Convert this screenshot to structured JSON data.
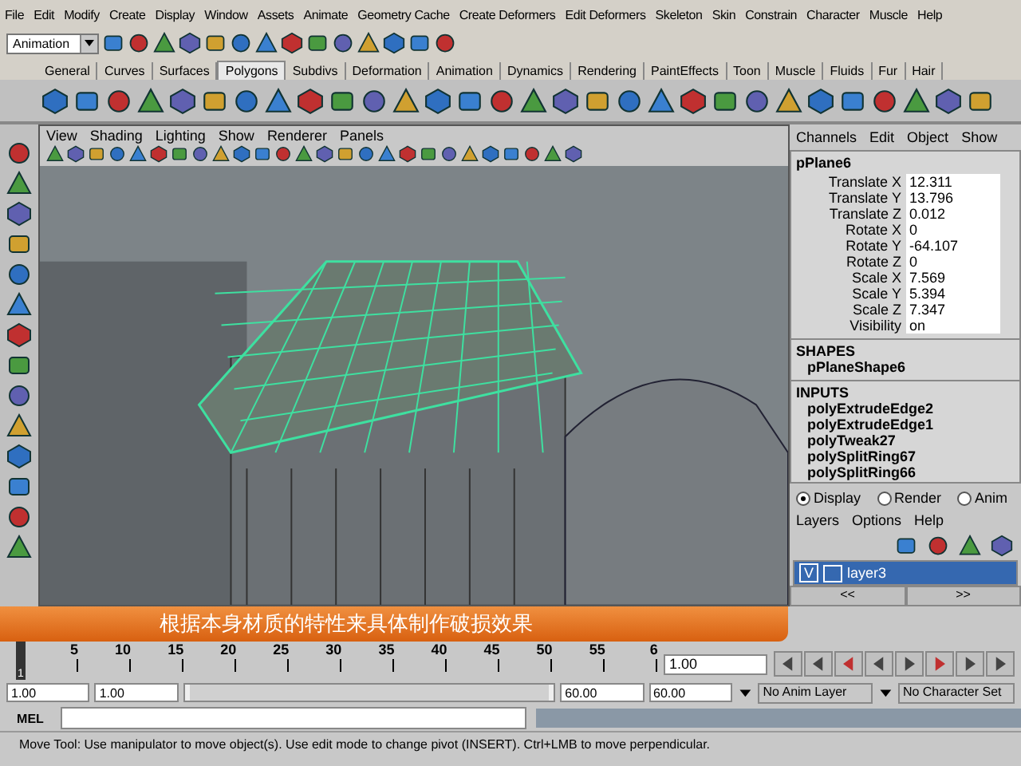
{
  "menu_bar": [
    "File",
    "Edit",
    "Modify",
    "Create",
    "Display",
    "Window",
    "Assets",
    "Animate",
    "Geometry Cache",
    "Create Deformers",
    "Edit Deformers",
    "Skeleton",
    "Skin",
    "Constrain",
    "Character",
    "Muscle",
    "Help"
  ],
  "status_line": {
    "mode": "Animation"
  },
  "shelf_tabs": [
    {
      "label": "General",
      "selected": false
    },
    {
      "label": "Curves",
      "selected": false
    },
    {
      "label": "Surfaces",
      "selected": false
    },
    {
      "label": "Polygons",
      "selected": true
    },
    {
      "label": "Subdivs",
      "selected": false
    },
    {
      "label": "Deformation",
      "selected": false
    },
    {
      "label": "Animation",
      "selected": false
    },
    {
      "label": "Dynamics",
      "selected": false
    },
    {
      "label": "Rendering",
      "selected": false
    },
    {
      "label": "PaintEffects",
      "selected": false
    },
    {
      "label": "Toon",
      "selected": false
    },
    {
      "label": "Muscle",
      "selected": false
    },
    {
      "label": "Fluids",
      "selected": false
    },
    {
      "label": "Fur",
      "selected": false
    },
    {
      "label": "Hair",
      "selected": false
    }
  ],
  "viewport": {
    "menus": [
      "View",
      "Shading",
      "Lighting",
      "Show",
      "Renderer",
      "Panels"
    ],
    "subtitle": "根据本身材质的特性来具体制作破损效果"
  },
  "channel_box": {
    "menus": [
      "Channels",
      "Edit",
      "Object",
      "Show"
    ],
    "object_name": "pPlane6",
    "attributes": [
      {
        "name": "Translate X",
        "value": "12.311"
      },
      {
        "name": "Translate Y",
        "value": "13.796"
      },
      {
        "name": "Translate Z",
        "value": "0.012"
      },
      {
        "name": "Rotate X",
        "value": "0"
      },
      {
        "name": "Rotate Y",
        "value": "-64.107"
      },
      {
        "name": "Rotate Z",
        "value": "0"
      },
      {
        "name": "Scale X",
        "value": "7.569"
      },
      {
        "name": "Scale Y",
        "value": "5.394"
      },
      {
        "name": "Scale Z",
        "value": "7.347"
      },
      {
        "name": "Visibility",
        "value": "on"
      }
    ],
    "shapes_header": "SHAPES",
    "shapes": [
      "pPlaneShape6"
    ],
    "inputs_header": "INPUTS",
    "inputs": [
      "polyExtrudeEdge2",
      "polyExtrudeEdge1",
      "polyTweak27",
      "polySplitRing67",
      "polySplitRing66"
    ]
  },
  "layer_editor": {
    "modes": [
      {
        "label": "Display",
        "selected": true
      },
      {
        "label": "Render",
        "selected": false
      },
      {
        "label": "Anim",
        "selected": false
      }
    ],
    "menus": [
      "Layers",
      "Options",
      "Help"
    ],
    "layers": [
      {
        "visibility": "V",
        "name": "layer3",
        "selected": true
      }
    ],
    "nav": [
      "<<",
      ">>"
    ]
  },
  "timeline": {
    "current_marker": "1",
    "ticks": [
      "5",
      "10",
      "15",
      "20",
      "25",
      "30",
      "35",
      "40",
      "45",
      "50",
      "55",
      "6"
    ],
    "current_time": "1.00",
    "level": 0
  },
  "range": {
    "start": "1.00",
    "range_start": "1.00",
    "range_end": "60.00",
    "end": "60.00",
    "anim_layer": "No Anim Layer",
    "character_set": "No Character Set",
    "level": 1
  },
  "command_line": {
    "label": "MEL"
  },
  "help_line": "Move Tool: Use manipulator to move object(s). Use edit mode to change pivot (INSERT).  Ctrl+LMB to move perpendicular."
}
